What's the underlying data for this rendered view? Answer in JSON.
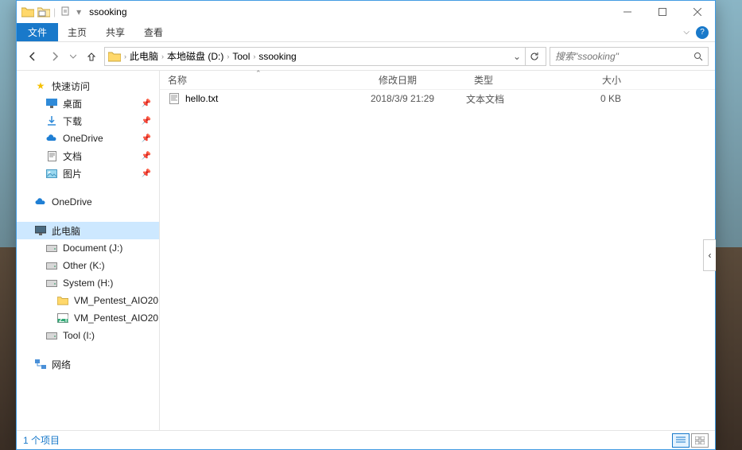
{
  "window": {
    "title": "ssooking"
  },
  "ribbon": {
    "file": "文件",
    "home": "主页",
    "share": "共享",
    "view": "查看"
  },
  "address": {
    "segments": [
      "此电脑",
      "本地磁盘 (D:)",
      "Tool",
      "ssooking"
    ]
  },
  "search": {
    "placeholder": "搜索\"ssooking\""
  },
  "sidebar": {
    "quick_access": "快速访问",
    "quick_items": [
      {
        "label": "桌面",
        "icon": "desktop",
        "pinned": true
      },
      {
        "label": "下载",
        "icon": "download",
        "pinned": true
      },
      {
        "label": "OneDrive",
        "icon": "onedrive",
        "pinned": true
      },
      {
        "label": "文档",
        "icon": "document",
        "pinned": true
      },
      {
        "label": "图片",
        "icon": "pictures",
        "pinned": true
      }
    ],
    "onedrive": "OneDrive",
    "this_pc": "此电脑",
    "drives": [
      {
        "label": "Document (J:)"
      },
      {
        "label": "Other (K:)"
      },
      {
        "label": "System (H:)"
      }
    ],
    "folders_under_system": [
      {
        "label": "VM_Pentest_AIO20",
        "icon": "folder"
      },
      {
        "label": "VM_Pentest_AIO20",
        "icon": "zip"
      }
    ],
    "tool_drive": "Tool (I:)",
    "network": "网络"
  },
  "columns": {
    "name": "名称",
    "date": "修改日期",
    "type": "类型",
    "size": "大小"
  },
  "files": [
    {
      "name": "hello.txt",
      "date": "2018/3/9 21:29",
      "type": "文本文档",
      "size": "0 KB"
    }
  ],
  "status": {
    "count": "1 个项目"
  }
}
